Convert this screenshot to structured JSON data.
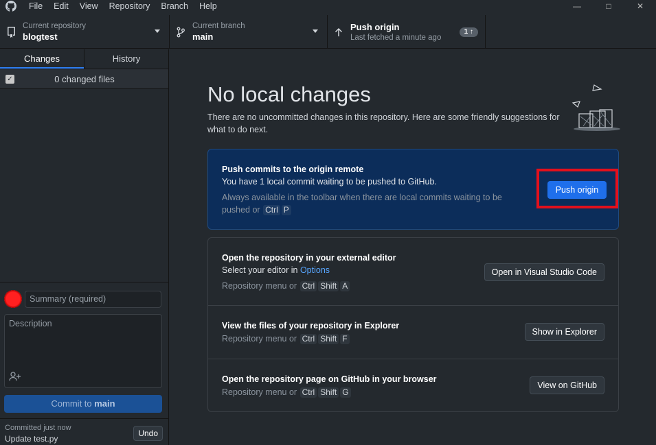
{
  "menu": [
    "File",
    "Edit",
    "View",
    "Repository",
    "Branch",
    "Help"
  ],
  "toolbar": {
    "repo_label": "Current repository",
    "repo_value": "blogtest",
    "branch_label": "Current branch",
    "branch_value": "main",
    "push_label": "Push origin",
    "push_sub": "Last fetched a minute ago",
    "push_badge": "1 ↑"
  },
  "sidebar": {
    "tabs": [
      "Changes",
      "History"
    ],
    "active_tab": "Changes",
    "changed_files": "0 changed files",
    "summary_placeholder": "Summary (required)",
    "description_placeholder": "Description",
    "commit_prefix": "Commit to ",
    "commit_branch": "main",
    "last_commit_time": "Committed just now",
    "last_commit_msg": "Update test.py",
    "undo_label": "Undo"
  },
  "main": {
    "heading": "No local changes",
    "subtext": "There are no uncommitted changes in this repository. Here are some friendly suggestions for what to do next.",
    "push_card": {
      "title": "Push commits to the origin remote",
      "line": "You have 1 local commit waiting to be pushed to GitHub.",
      "muted": "Always available in the toolbar when there are local commits waiting to be",
      "muted2": "pushed or",
      "keys": [
        "Ctrl",
        "P"
      ],
      "button": "Push origin"
    },
    "rows": [
      {
        "title": "Open the repository in your external editor",
        "line_prefix": "Select your editor in ",
        "line_link": "Options",
        "menu_text": "Repository menu or",
        "keys": [
          "Ctrl",
          "Shift",
          "A"
        ],
        "button": "Open in Visual Studio Code"
      },
      {
        "title": "View the files of your repository in Explorer",
        "menu_text": "Repository menu or",
        "keys": [
          "Ctrl",
          "Shift",
          "F"
        ],
        "button": "Show in Explorer"
      },
      {
        "title": "Open the repository page on GitHub in your browser",
        "menu_text": "Repository menu or",
        "keys": [
          "Ctrl",
          "Shift",
          "G"
        ],
        "button": "View on GitHub"
      }
    ]
  },
  "colors": {
    "accent": "#1f6feb",
    "highlight": "#e3101c",
    "push_card_bg": "#0c2d5a"
  },
  "icons": [
    "github-logo-icon",
    "repo-icon",
    "branch-icon",
    "arrow-up-icon",
    "caret-down-icon",
    "checkbox-icon",
    "avatar",
    "add-coauthor-icon",
    "minimize-icon",
    "maximize-icon",
    "close-icon"
  ]
}
